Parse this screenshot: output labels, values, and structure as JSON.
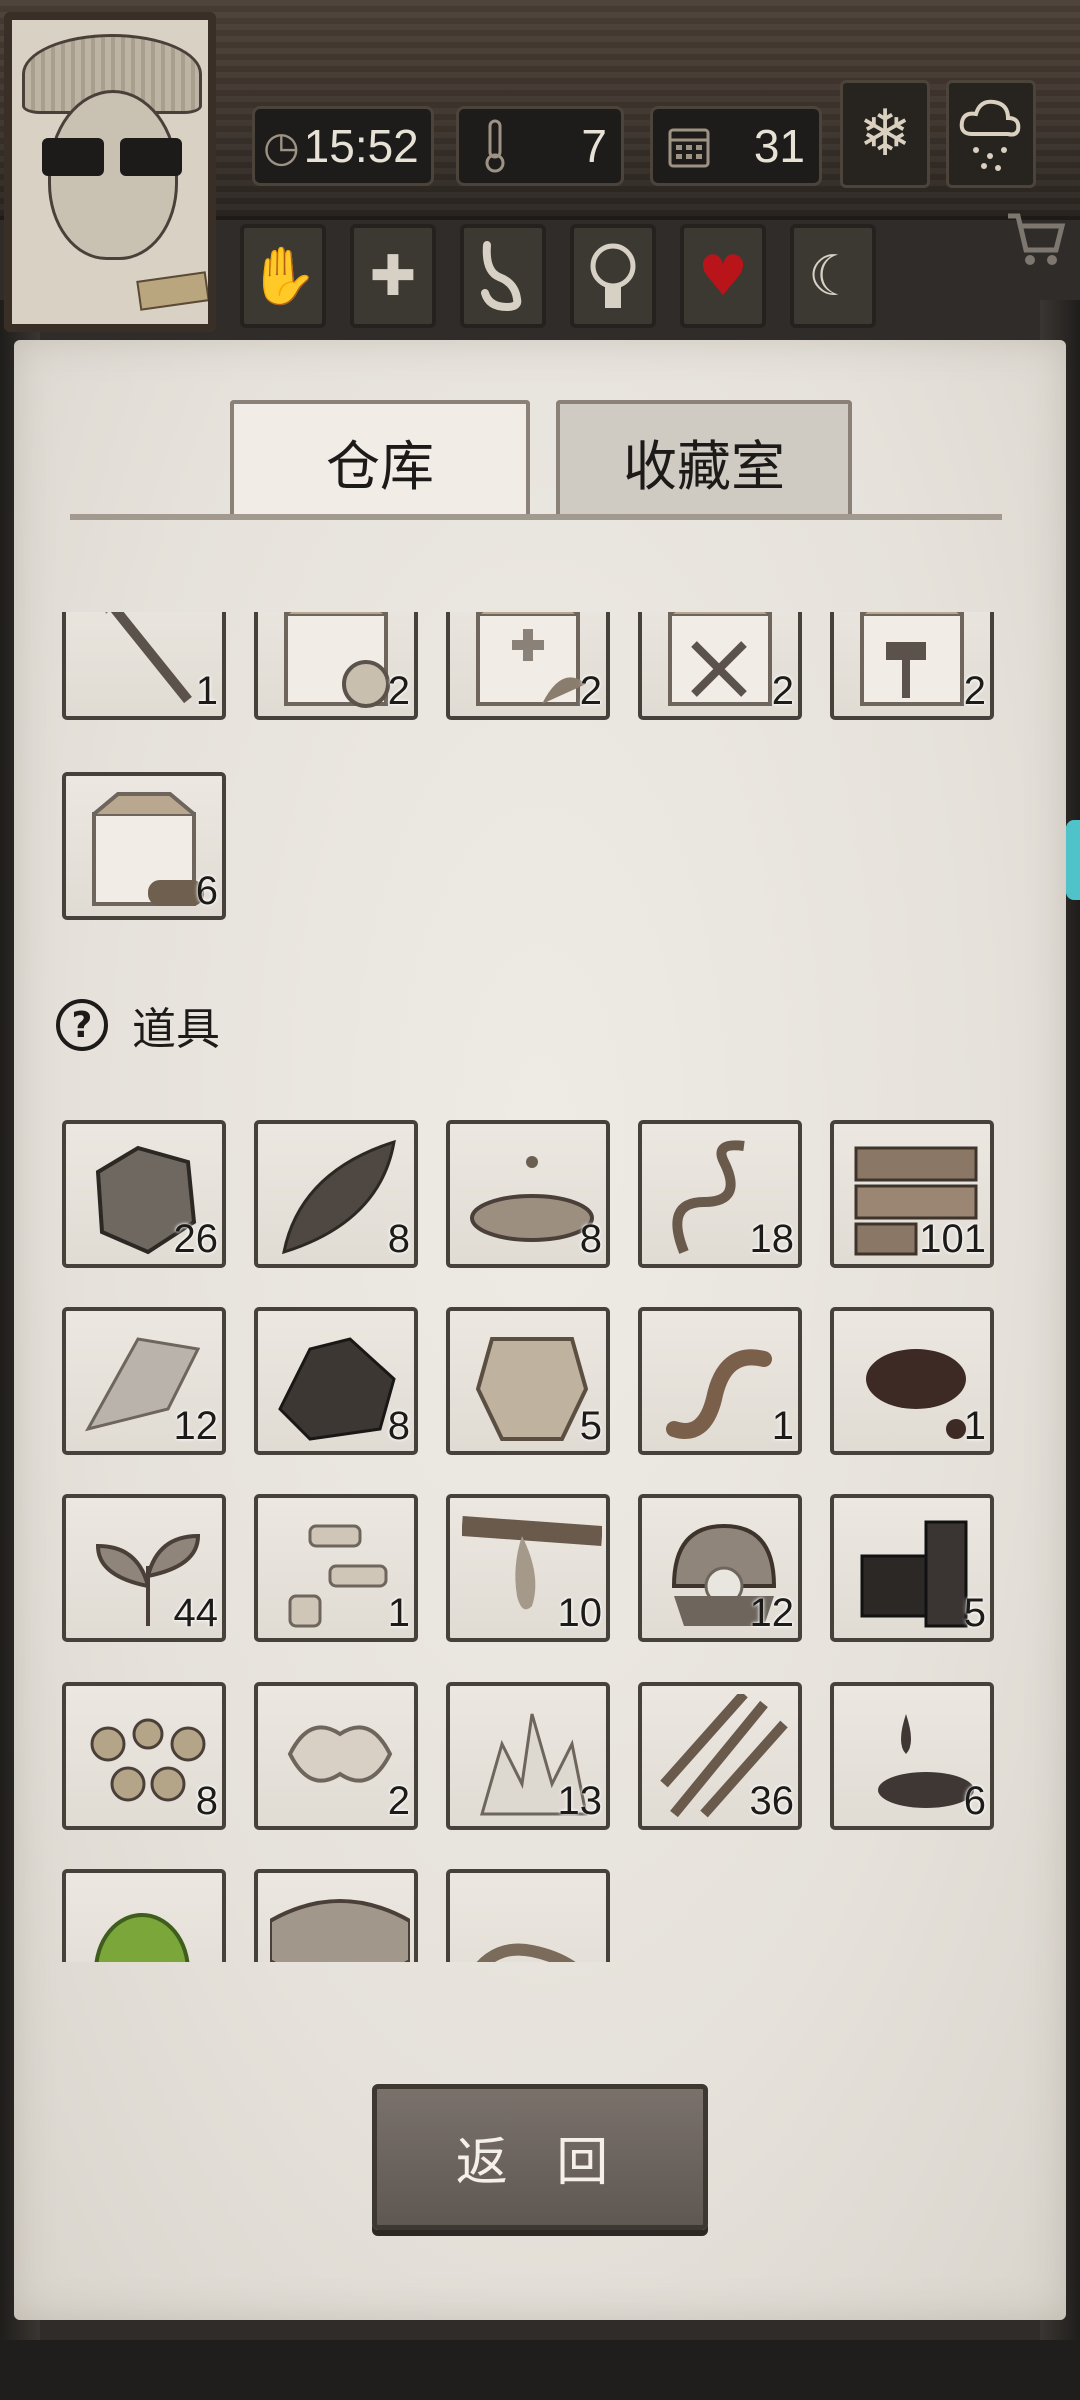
{
  "hud": {
    "time": "15:52",
    "temperature": "7",
    "day": "31"
  },
  "tabs": {
    "warehouse": "仓库",
    "collection": "收藏室"
  },
  "top_items": [
    {
      "icon": "spear-tool-icon",
      "count": "1"
    },
    {
      "icon": "food-supply-box-icon",
      "count": "2"
    },
    {
      "icon": "medical-supply-box-icon",
      "count": "2"
    },
    {
      "icon": "weapon-supply-box-icon",
      "count": "2"
    },
    {
      "icon": "tool-supply-box-icon",
      "count": "2"
    },
    {
      "icon": "wood-supply-box-icon",
      "count": "6"
    }
  ],
  "section": {
    "title": "道具"
  },
  "items": [
    {
      "icon": "stone-icon",
      "count": "26"
    },
    {
      "icon": "leaf-icon",
      "count": "8"
    },
    {
      "icon": "water-puddle-icon",
      "count": "8"
    },
    {
      "icon": "vine-icon",
      "count": "18"
    },
    {
      "icon": "wood-planks-icon",
      "count": "101"
    },
    {
      "icon": "flint-icon",
      "count": "12"
    },
    {
      "icon": "ore-icon",
      "count": "8"
    },
    {
      "icon": "animal-hide-icon",
      "count": "5"
    },
    {
      "icon": "worm-icon",
      "count": "1"
    },
    {
      "icon": "blood-icon",
      "count": "1"
    },
    {
      "icon": "herb-icon",
      "count": "44"
    },
    {
      "icon": "bone-pieces-icon",
      "count": "1"
    },
    {
      "icon": "resin-icon",
      "count": "10"
    },
    {
      "icon": "pearl-shell-icon",
      "count": "12"
    },
    {
      "icon": "charcoal-icon",
      "count": "5"
    },
    {
      "icon": "gold-nuggets-icon",
      "count": "8"
    },
    {
      "icon": "fiber-icon",
      "count": "2"
    },
    {
      "icon": "crystal-icon",
      "count": "13"
    },
    {
      "icon": "bamboo-arrows-icon",
      "count": "36"
    },
    {
      "icon": "oil-drop-icon",
      "count": "6"
    },
    {
      "icon": "green-gem-icon",
      "count": ""
    },
    {
      "icon": "fish-icon",
      "count": ""
    },
    {
      "icon": "rope-icon",
      "count": ""
    }
  ],
  "buttons": {
    "back": "返 回"
  },
  "colors": {
    "paper": "#e9e6e0",
    "slot_border": "#47413b",
    "heart": "#b8141a",
    "button": "#6c645e"
  }
}
